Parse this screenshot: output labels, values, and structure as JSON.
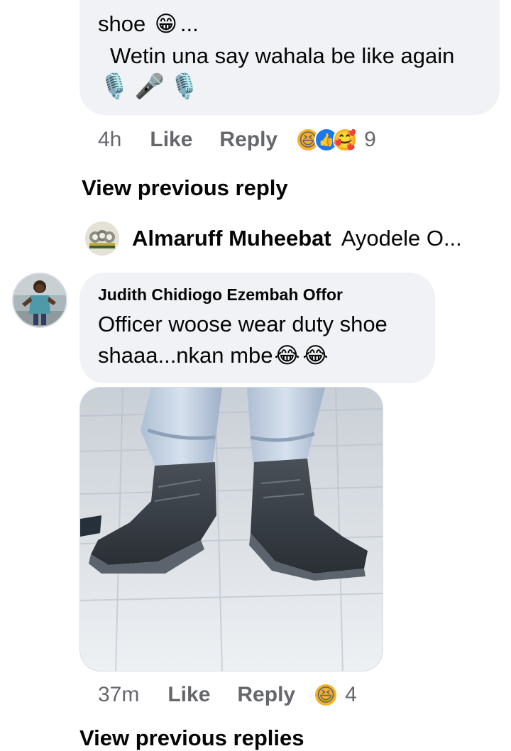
{
  "comment1": {
    "line1": "shoe",
    "line1_emoji": "😁",
    "line1_tail": "...",
    "line2": "Wetin una say wahala be like again",
    "mics": [
      "🎙️",
      "🎤",
      "🎙️"
    ],
    "time": "4h",
    "like_label": "Like",
    "reply_label": "Reply",
    "reactions": [
      "😆",
      "👍",
      "🥰"
    ],
    "reaction_count": "9"
  },
  "view_previous_reply": "View previous reply",
  "reply_preview": {
    "name": "Almaruff Muheebat",
    "text": "Ayodele O..."
  },
  "comment2": {
    "author": "Judith Chidiogo Ezembah Offor",
    "line1": "Officer woose wear duty shoe",
    "line2": "shaaa...nkan mbe",
    "emojis": [
      "😂",
      "😂"
    ],
    "time": "37m",
    "like_label": "Like",
    "reply_label": "Reply",
    "reaction": "😆",
    "reaction_count": "4"
  },
  "partial_next": "View previous replies"
}
